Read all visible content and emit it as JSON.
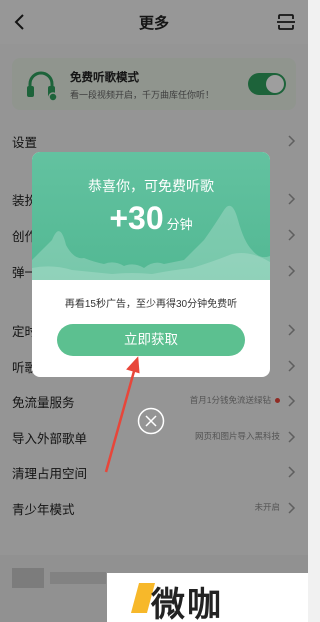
{
  "header": {
    "title": "更多"
  },
  "free_mode": {
    "title": "免费听歌模式",
    "subtitle": "看一段视频开启，千万曲库任你听！",
    "enabled": true
  },
  "menu": [
    {
      "label": "设置",
      "extra": ""
    },
    {
      "label": "装扮",
      "extra": ""
    },
    {
      "label": "创作",
      "extra": ""
    },
    {
      "label": "弹一",
      "extra": ""
    },
    {
      "label": "定时",
      "extra": ""
    },
    {
      "label": "听歌",
      "extra": ""
    },
    {
      "label": "免流量服务",
      "extra": "首月1分钱免流送绿钻"
    },
    {
      "label": "导入外部歌单",
      "extra": "网页和图片导入黑科技"
    },
    {
      "label": "清理占用空间",
      "extra": ""
    },
    {
      "label": "青少年模式",
      "extra": "未开启"
    }
  ],
  "dialog": {
    "heading": "恭喜你，可免费听歌",
    "amount": "+30",
    "unit": "分钟",
    "description": "再看15秒广告，至少再得30分钟免费听",
    "button": "立即获取"
  },
  "watermark": "微咖",
  "colors": {
    "accent_green": "#2fa15e",
    "dialog_green": "#5cc090",
    "arrow_red": "#e8463a"
  }
}
